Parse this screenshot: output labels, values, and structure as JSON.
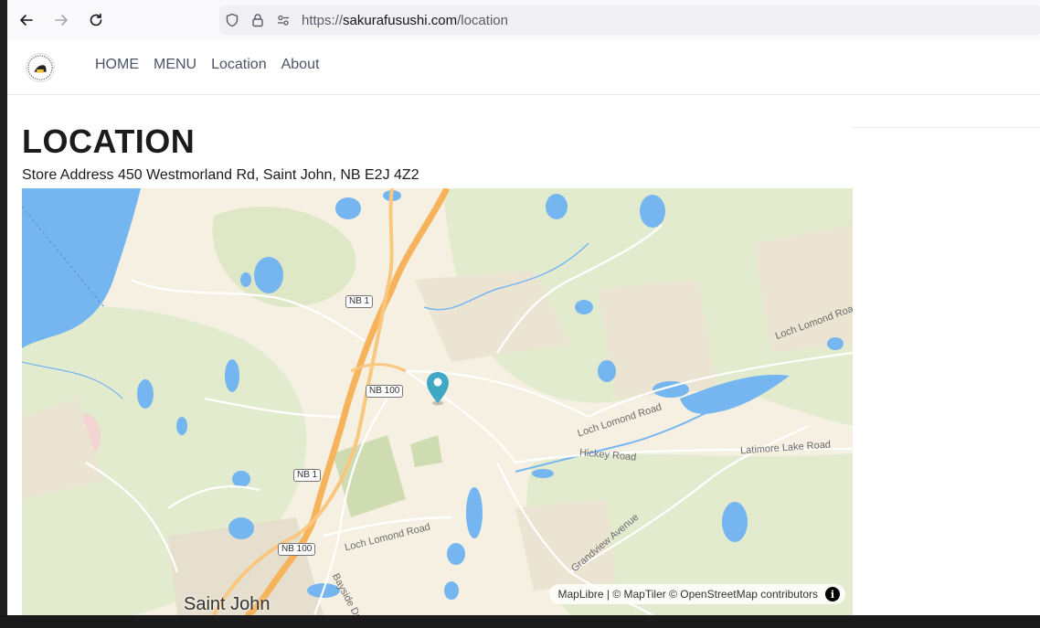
{
  "browser": {
    "url_protocol": "https://",
    "url_host": "sakurafusushi.com",
    "url_path": "/location"
  },
  "site": {
    "logo_alt": "Sakura Fu Sushi",
    "nav": [
      {
        "label": "HOME"
      },
      {
        "label": "MENU"
      },
      {
        "label": "Location"
      },
      {
        "label": "About"
      }
    ]
  },
  "main": {
    "title": "LOCATION",
    "address": "Store Address 450 Westmorland Rd, Saint John, NB E2J 4Z2"
  },
  "map": {
    "city": "Saint John",
    "shields": [
      "NB 1",
      "NB 100",
      "NB 1",
      "NB 100"
    ],
    "roads": [
      "Loch Lomond Road",
      "Loch Lomond Road",
      "Hickey Road",
      "Latimore Lake Road",
      "Loch Lomond Road",
      "Grandview Avenue",
      "Bayside Dr"
    ],
    "attribution": "MapLibre | © MapTiler © OpenStreetMap contributors",
    "info_symbol": "i",
    "colors": {
      "water": "#76b6f0",
      "park": "#dfe8c8",
      "highway": "#f7b35c",
      "land": "#f6f0e2",
      "marker": "#3fa9c5"
    }
  }
}
